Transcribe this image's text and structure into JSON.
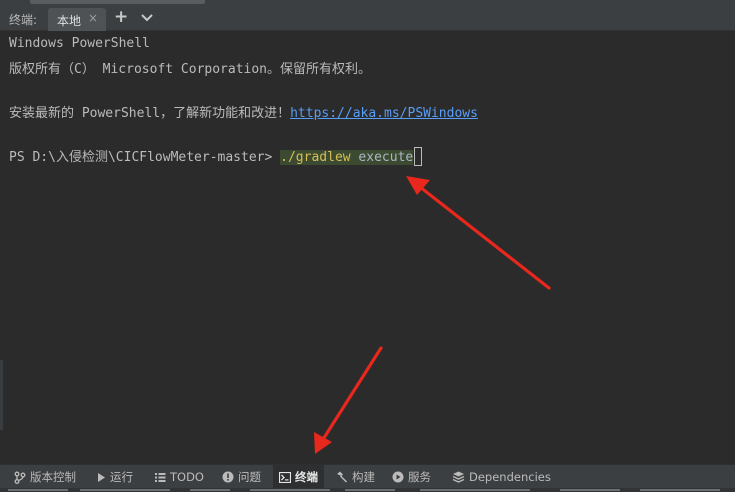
{
  "window": {
    "panel_label": "终端:"
  },
  "tabs": [
    {
      "label": "本地",
      "close": "×"
    }
  ],
  "tab_actions": {
    "add": "+"
  },
  "terminal": {
    "lines": {
      "l1": "Windows PowerShell",
      "l2": "版权所有（C） Microsoft Corporation。保留所有权利。",
      "l3_prefix": "安装最新的 PowerShell，了解新功能和改进！",
      "l3_link": "https://aka.ms/PSWindows",
      "prompt": "PS D:\\入侵检测\\CICFlowMeter-master> ",
      "cmd_exec": "./gradlew",
      "cmd_arg": " execute"
    }
  },
  "statusbar": {
    "items": [
      {
        "label": "版本控制",
        "icon": "branch-icon"
      },
      {
        "label": "运行",
        "icon": "play-icon"
      },
      {
        "label": "TODO",
        "icon": "list-icon"
      },
      {
        "label": "问题",
        "icon": "info-icon"
      },
      {
        "label": "终端",
        "icon": "terminal-icon",
        "active": true
      },
      {
        "label": "构建",
        "icon": "hammer-icon"
      },
      {
        "label": "服务",
        "icon": "services-icon"
      },
      {
        "label": "Dependencies",
        "icon": "dependencies-icon"
      }
    ]
  },
  "colors": {
    "annotation_arrow": "#e8271d",
    "link": "#589df6",
    "command": "#d6bf55"
  }
}
